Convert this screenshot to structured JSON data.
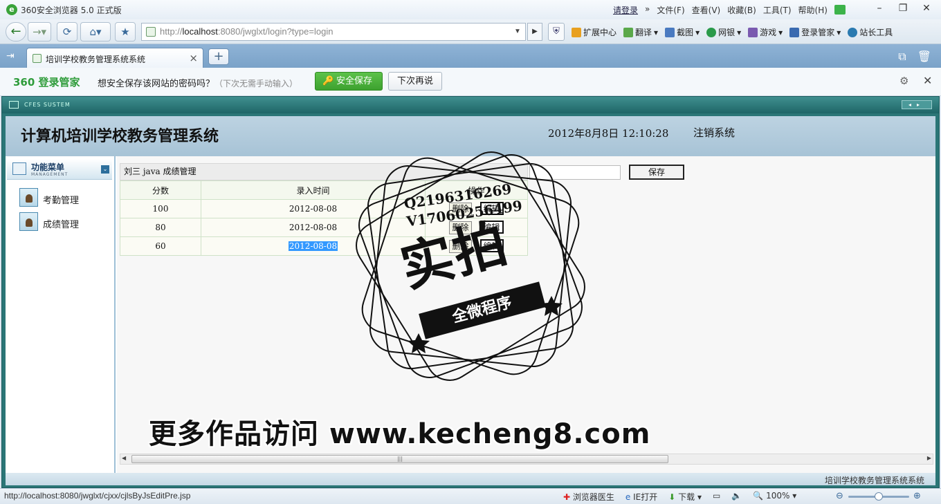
{
  "browser": {
    "title": "360安全浏览器 5.0 正式版",
    "login_link": "请登录",
    "menus": [
      "文件(F)",
      "查看(V)",
      "收藏(B)",
      "工具(T)",
      "帮助(H)"
    ],
    "url_prefix": "http://",
    "url_host": "localhost",
    "url_rest": ":8080/jwglxt/login?type=login",
    "toolbar": [
      "扩展中心",
      "翻译",
      "截图",
      "网银",
      "游戏",
      "登录管家",
      "站长工具"
    ],
    "tab_title": "培训学校教务管理系统系统"
  },
  "password_bar": {
    "brand": "360 登录管家",
    "question": "想安全保存该网站的密码吗？",
    "hint": "（下次无需手动输入）",
    "save_button": "安全保存",
    "later_button": "下次再说"
  },
  "app": {
    "system_label": "CFES SUSTEM",
    "title": "计算机培训学校教务管理系统",
    "datetime": "2012年8月8日  12:10:28",
    "logout": "注销系统",
    "menu": {
      "title": "功能菜单",
      "subtitle": "MANAGEMENT",
      "items": [
        "考勤管理",
        "成绩管理"
      ]
    },
    "grades": {
      "heading": "刘三 java 成绩管理",
      "headers": [
        "分数",
        "录入时间",
        "操作"
      ],
      "rows": [
        {
          "score": "100",
          "date": "2012-08-08"
        },
        {
          "score": "80",
          "date": "2012-08-08"
        },
        {
          "score": "60",
          "date": "2012-08-08"
        }
      ],
      "delete_label": "删除",
      "edit_label": "编辑",
      "input_value": "",
      "save_label": "保存"
    },
    "footer_text": "培训学校教务管理系统系统"
  },
  "status": {
    "url": "http://localhost:8080/jwglxt/cjxx/cjlsByJsEditPre.jsp",
    "doctor": "浏览器医生",
    "ie_open": "IE打开",
    "download": "下载",
    "zoom": "100%",
    "zoom_fraction": 0.5
  },
  "watermark": {
    "qq": "Q2196316269",
    "vx": "V17060256499",
    "big": "实拍",
    "ribbon": "全微程序",
    "more": "更多作品访问 www.kecheng8.com"
  },
  "colors": {
    "frame": "#2b7677",
    "header": "#b3cddc",
    "save_green": "#46a83a",
    "selection": "#3399ff"
  }
}
